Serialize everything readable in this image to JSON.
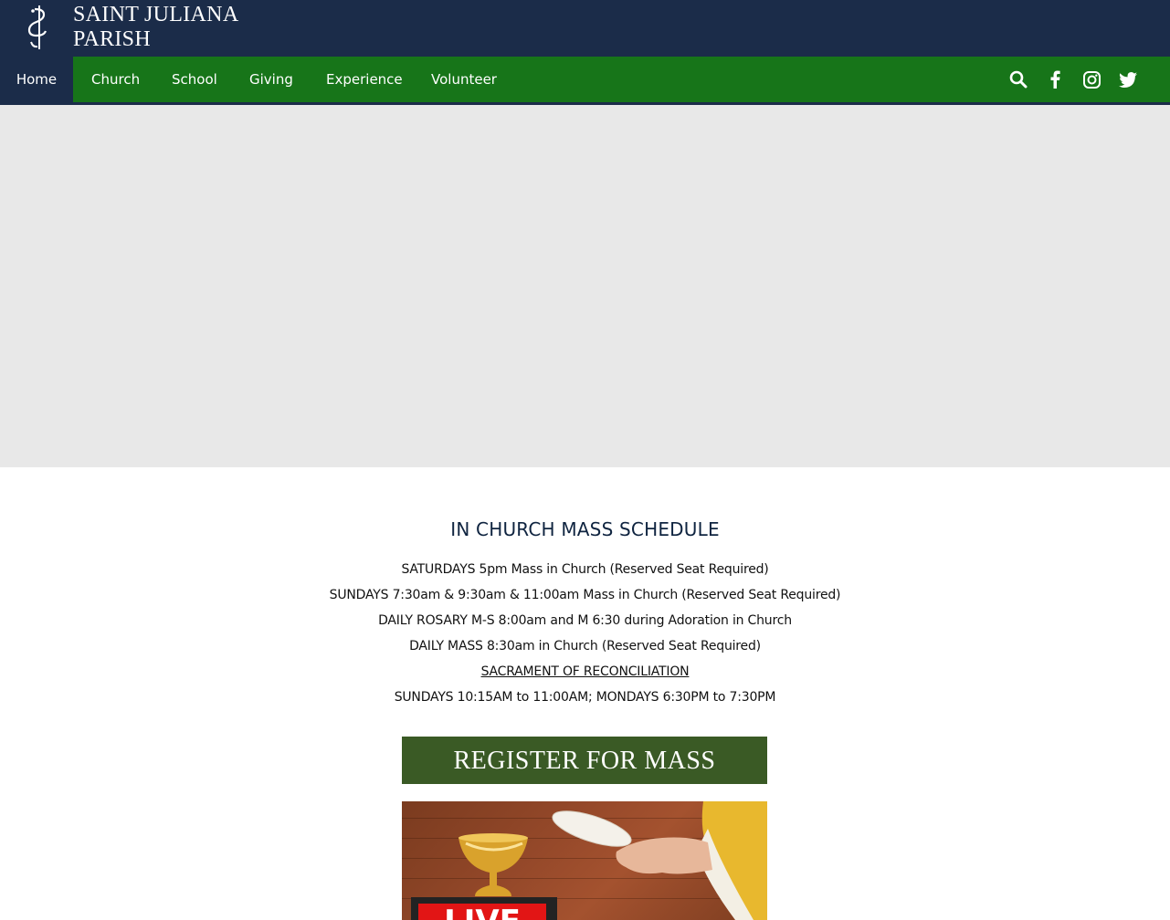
{
  "brand": {
    "line1": "SAINT JULIANA",
    "line2": "PARISH",
    "logo_icon": "js-monogram-icon"
  },
  "nav": {
    "items": [
      {
        "label": "Home",
        "active": true
      },
      {
        "label": "Church"
      },
      {
        "label": "School"
      },
      {
        "label": "Giving"
      },
      {
        "label": "Experience"
      },
      {
        "label": "Volunteer"
      }
    ],
    "icons": [
      "search-icon",
      "facebook-icon",
      "instagram-icon",
      "twitter-icon"
    ]
  },
  "colors": {
    "header": "#1b2c49",
    "nav": "#177519",
    "hero": "#e8e8e8",
    "register_button": "#3a5a25",
    "live_badge": "#e21515"
  },
  "schedule": {
    "title": "IN CHURCH  MASS SCHEDULE",
    "lines": [
      "SATURDAYS 5pm Mass in Church (Reserved Seat Required)",
      "SUNDAYS 7:30am & 9:30am & 11:00am Mass in Church (Reserved Seat Required)",
      "DAILY ROSARY M-S 8:00am and M 6:30 during Adoration in Church",
      "DAILY MASS 8:30am in Church (Reserved Seat Required)",
      "SACRAMENT OF RECONCILIATION",
      "SUNDAYS 10:15AM to 11:00AM; MONDAYS 6:30PM to 7:30PM"
    ]
  },
  "register": {
    "label": "REGISTER FOR MASS"
  },
  "live": {
    "badge": "LIVE"
  }
}
